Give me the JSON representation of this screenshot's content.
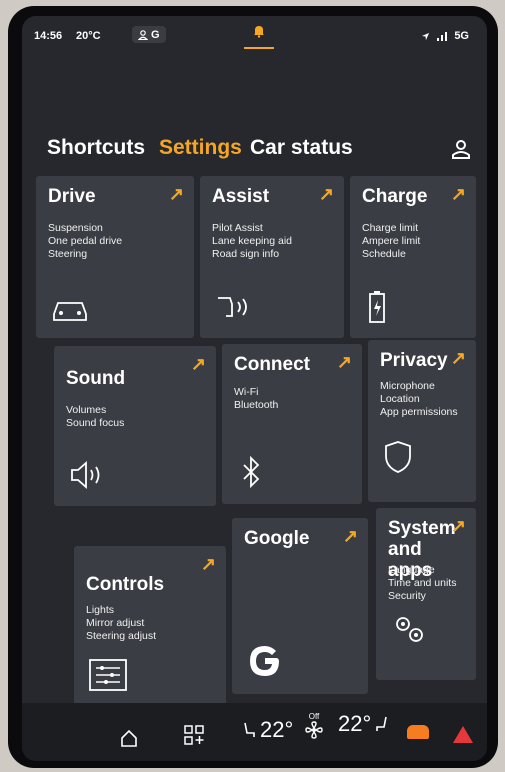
{
  "status": {
    "time": "14:56",
    "temperature": "20°C",
    "profile": "G",
    "network": "5G"
  },
  "tabs": [
    {
      "label": "Shortcuts",
      "active": false
    },
    {
      "label": "Settings",
      "active": true
    },
    {
      "label": "Car status",
      "active": false
    }
  ],
  "tiles": {
    "drive": {
      "title": "Drive",
      "items": [
        "Suspension",
        "One pedal drive",
        "Steering"
      ],
      "icon": "car-icon"
    },
    "assist": {
      "title": "Assist",
      "items": [
        "Pilot Assist",
        "Lane keeping aid",
        "Road sign info"
      ],
      "icon": "assist-icon"
    },
    "charge": {
      "title": "Charge",
      "items": [
        "Charge limit",
        "Ampere limit",
        "Schedule"
      ],
      "icon": "battery-icon"
    },
    "sound": {
      "title": "Sound",
      "items": [
        "Volumes",
        "Sound focus"
      ],
      "icon": "speaker-icon"
    },
    "connect": {
      "title": "Connect",
      "items": [
        "Wi-Fi",
        "Bluetooth"
      ],
      "icon": "bluetooth-icon"
    },
    "privacy": {
      "title": "Privacy",
      "items": [
        "Microphone",
        "Location",
        "App permissions"
      ],
      "icon": "shield-icon"
    },
    "controls": {
      "title": "Controls",
      "items": [
        "Lights",
        "Mirror adjust",
        "Steering adjust"
      ],
      "icon": "controls-icon"
    },
    "google": {
      "title": "Google",
      "items": [],
      "icon": "google-icon"
    },
    "system": {
      "title": "System and apps",
      "items": [
        "Language",
        "Time and units",
        "Security"
      ],
      "icon": "gears-icon"
    }
  },
  "dock": {
    "left_temp": "22°",
    "fan_label": "Off",
    "right_temp": "22°"
  },
  "colors": {
    "accent": "#f5a623",
    "background": "#26282d",
    "tile": "#3a3d43",
    "hazard": "#e5383b"
  }
}
